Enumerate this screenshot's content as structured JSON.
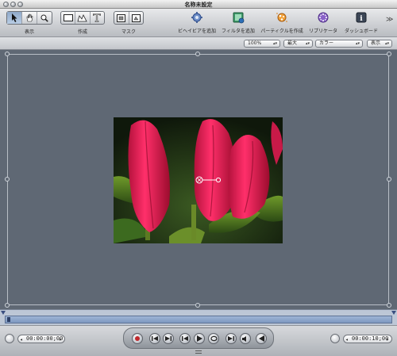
{
  "window": {
    "title": "名称未設定"
  },
  "toolbar": {
    "view_label": "表示",
    "create_label": "作成",
    "mask_label": "マスク",
    "add_behavior": "ビヘイビアを追加",
    "add_filter": "フィルタを追加",
    "make_particles": "パーティクルを作成",
    "replicate": "リプリケータ",
    "dashboard": "ダッシュボード",
    "overflow": "≫"
  },
  "optionbar": {
    "zoom": "100%",
    "resolution": "最大",
    "channels": "カラー",
    "view": "表示"
  },
  "transport": {
    "current_time": "00:00:00;00",
    "duration": "00:00:10;00"
  },
  "colors": {
    "canvas": "#5f6874",
    "accent_behavior": "#2a5db0",
    "accent_filter": "#2f8f56",
    "accent_particles": "#e08a1a",
    "accent_replicate": "#7a4fb8",
    "record": "#c0282c"
  }
}
